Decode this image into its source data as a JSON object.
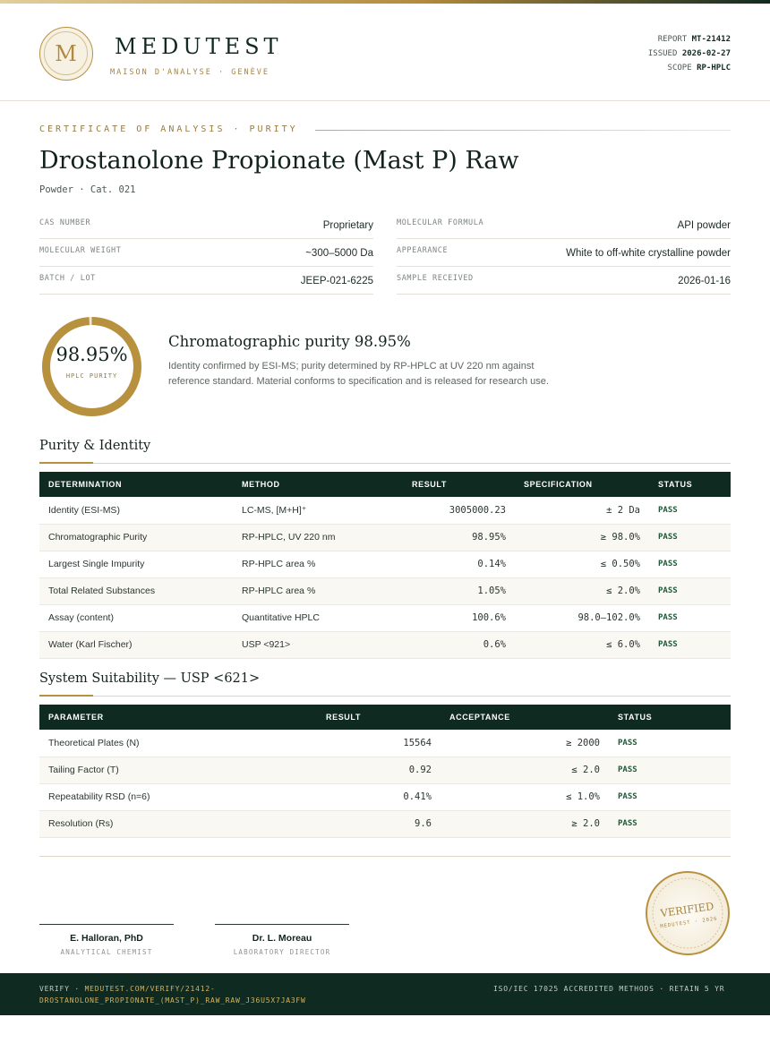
{
  "header": {
    "logo_letter": "M",
    "brand": "MEDUTEST",
    "tagline": "MAISON D'ANALYSE · GENÈVE",
    "report_label": "REPORT",
    "report_value": "MT-21412",
    "issued_label": "ISSUED",
    "issued_value": "2026-02-27",
    "scope_label": "SCOPE",
    "scope_value": "RP-HPLC"
  },
  "title_block": {
    "eyebrow": "CERTIFICATE OF ANALYSIS · PURITY",
    "title": "Drostanolone Propionate (Mast P) Raw",
    "subtitle": "Powder · Cat. 021"
  },
  "specs": [
    {
      "key": "CAS NUMBER",
      "value": "Proprietary"
    },
    {
      "key": "MOLECULAR FORMULA",
      "value": "API powder"
    },
    {
      "key": "MOLECULAR WEIGHT",
      "value": "~300–5000 Da"
    },
    {
      "key": "APPEARANCE",
      "value": "White to off-white crystalline powder"
    },
    {
      "key": "BATCH / LOT",
      "value": "JEEP-021-6225"
    },
    {
      "key": "SAMPLE RECEIVED",
      "value": "2026-01-16"
    }
  ],
  "purity": {
    "value": "98.95%",
    "fraction": 0.9895,
    "ring_label": "HPLC PURITY",
    "heading": "Chromatographic purity 98.95%",
    "text": "Identity confirmed by ESI-MS; purity determined by RP-HPLC at UV 220 nm against reference standard. Material conforms to specification and is released for research use."
  },
  "purity_identity": {
    "title": "Purity & Identity",
    "headers": [
      "DETERMINATION",
      "METHOD",
      "RESULT",
      "SPECIFICATION",
      "STATUS"
    ],
    "rows": [
      {
        "det": "Identity (ESI-MS)",
        "method": "LC-MS, [M+H]⁺",
        "result": "3005000.23",
        "spec": "± 2 Da",
        "status": "PASS"
      },
      {
        "det": "Chromatographic Purity",
        "method": "RP-HPLC, UV 220 nm",
        "result": "98.95%",
        "spec": "≥ 98.0%",
        "status": "PASS"
      },
      {
        "det": "Largest Single Impurity",
        "method": "RP-HPLC area %",
        "result": "0.14%",
        "spec": "≤ 0.50%",
        "status": "PASS"
      },
      {
        "det": "Total Related Substances",
        "method": "RP-HPLC area %",
        "result": "1.05%",
        "spec": "≤ 2.0%",
        "status": "PASS"
      },
      {
        "det": "Assay (content)",
        "method": "Quantitative HPLC",
        "result": "100.6%",
        "spec": "98.0–102.0%",
        "status": "PASS"
      },
      {
        "det": "Water (Karl Fischer)",
        "method": "USP <921>",
        "result": "0.6%",
        "spec": "≤ 6.0%",
        "status": "PASS"
      }
    ]
  },
  "system_suitability": {
    "title": "System Suitability — USP <621>",
    "headers": [
      "PARAMETER",
      "RESULT",
      "ACCEPTANCE",
      "STATUS"
    ],
    "rows": [
      {
        "param": "Theoretical Plates (N)",
        "result": "15564",
        "accept": "≥ 2000",
        "status": "PASS"
      },
      {
        "param": "Tailing Factor (T)",
        "result": "0.92",
        "accept": "≤ 2.0",
        "status": "PASS"
      },
      {
        "param": "Repeatability RSD (n=6)",
        "result": "0.41%",
        "accept": "≤ 1.0%",
        "status": "PASS"
      },
      {
        "param": "Resolution (Rs)",
        "result": "9.6",
        "accept": "≥ 2.0",
        "status": "PASS"
      }
    ]
  },
  "signatures": [
    {
      "name": "E. Halloran, PhD",
      "role": "ANALYTICAL CHEMIST"
    },
    {
      "name": "Dr. L. Moreau",
      "role": "LABORATORY DIRECTOR"
    }
  ],
  "stamp": {
    "main": "VERIFIED",
    "sub": "MEDUTEST · 2026"
  },
  "footer": {
    "verify_prefix": "VERIFY · ",
    "verify_url": "MEDUTEST.COM/VERIFY/21412-DROSTANOLONE_PROPIONATE_(MAST_P)_RAW_RAW_J36U5X7JA3FW",
    "right": "ISO/IEC 17025 ACCREDITED METHODS · RETAIN 5 YR"
  },
  "colors": {
    "primary": "#0f2a20",
    "gold": "#b8913f",
    "pass": "#1e5a38"
  }
}
